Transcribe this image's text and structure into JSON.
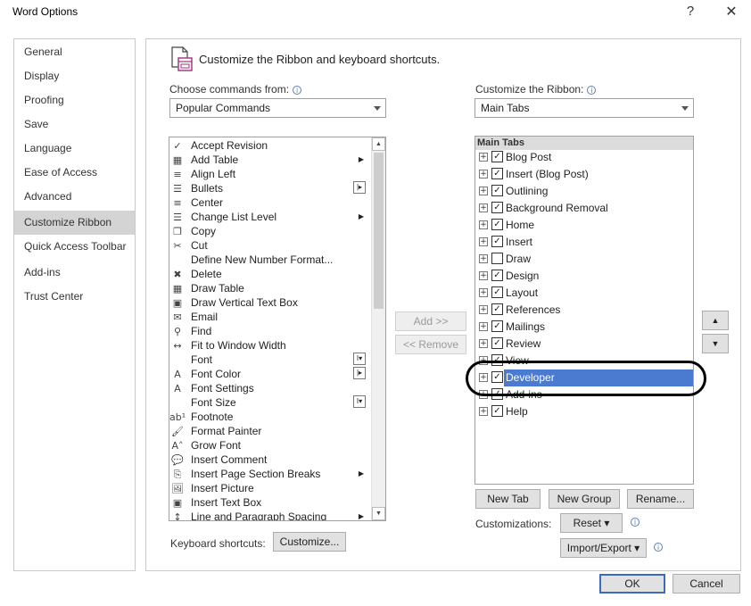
{
  "window": {
    "title": "Word Options",
    "help_label": "?",
    "close_label": "✕"
  },
  "nav": {
    "items": [
      {
        "label": "General"
      },
      {
        "label": "Display"
      },
      {
        "label": "Proofing"
      },
      {
        "label": "Save"
      },
      {
        "label": "Language"
      },
      {
        "label": "Ease of Access"
      },
      {
        "label": "Advanced"
      },
      {
        "label": "Customize Ribbon",
        "selected": true
      },
      {
        "label": "Quick Access Toolbar"
      },
      {
        "label": "Add-ins"
      },
      {
        "label": "Trust Center"
      }
    ]
  },
  "header": {
    "text": "Customize the Ribbon and keyboard shortcuts."
  },
  "left_panel": {
    "choose_label": "Choose commands from:",
    "choose_value": "Popular Commands",
    "commands": [
      {
        "label": "Accept Revision",
        "icon": "accept-icon",
        "glyph": "✓"
      },
      {
        "label": "Add Table",
        "icon": "table-icon",
        "glyph": "▦",
        "submenu": true
      },
      {
        "label": "Align Left",
        "icon": "align-left-icon",
        "glyph": "≡"
      },
      {
        "label": "Bullets",
        "icon": "bullets-icon",
        "glyph": "☰",
        "control": "|▸"
      },
      {
        "label": "Center",
        "icon": "center-icon",
        "glyph": "≡"
      },
      {
        "label": "Change List Level",
        "icon": "list-level-icon",
        "glyph": "☰",
        "submenu": true
      },
      {
        "label": "Copy",
        "icon": "copy-icon",
        "glyph": "❐"
      },
      {
        "label": "Cut",
        "icon": "cut-icon",
        "glyph": "✂"
      },
      {
        "label": "Define New Number Format...",
        "icon": "",
        "glyph": ""
      },
      {
        "label": "Delete",
        "icon": "delete-icon",
        "glyph": "✖"
      },
      {
        "label": "Draw Table",
        "icon": "draw-table-icon",
        "glyph": "▦"
      },
      {
        "label": "Draw Vertical Text Box",
        "icon": "text-box-icon",
        "glyph": "▣"
      },
      {
        "label": "Email",
        "icon": "email-icon",
        "glyph": "✉"
      },
      {
        "label": "Find",
        "icon": "find-icon",
        "glyph": "⚲"
      },
      {
        "label": "Fit to Window Width",
        "icon": "fit-width-icon",
        "glyph": "↔"
      },
      {
        "label": "Font",
        "icon": "",
        "glyph": "",
        "control": "I▾"
      },
      {
        "label": "Font Color",
        "icon": "font-color-icon",
        "glyph": "A",
        "control": "|▸"
      },
      {
        "label": "Font Settings",
        "icon": "font-settings-icon",
        "glyph": "A"
      },
      {
        "label": "Font Size",
        "icon": "",
        "glyph": "",
        "control": "I▾"
      },
      {
        "label": "Footnote",
        "icon": "footnote-icon",
        "glyph": "ab¹"
      },
      {
        "label": "Format Painter",
        "icon": "format-painter-icon",
        "glyph": "🖌"
      },
      {
        "label": "Grow Font",
        "icon": "grow-font-icon",
        "glyph": "A˄"
      },
      {
        "label": "Insert Comment",
        "icon": "comment-icon",
        "glyph": "💬"
      },
      {
        "label": "Insert Page  Section Breaks",
        "icon": "page-break-icon",
        "glyph": "⎘",
        "submenu": true
      },
      {
        "label": "Insert Picture",
        "icon": "picture-icon",
        "glyph": "🖼"
      },
      {
        "label": "Insert Text Box",
        "icon": "text-box-icon",
        "glyph": "▣"
      },
      {
        "label": "Line and Paragraph Spacing",
        "icon": "line-spacing-icon",
        "glyph": "↕",
        "submenu": true
      }
    ]
  },
  "middle": {
    "add_label": "Add >>",
    "remove_label": "<< Remove"
  },
  "right_panel": {
    "customize_label": "Customize the Ribbon:",
    "customize_value": "Main Tabs",
    "tree_header": "Main Tabs",
    "tabs": [
      {
        "label": "Blog Post",
        "checked": true
      },
      {
        "label": "Insert (Blog Post)",
        "checked": true
      },
      {
        "label": "Outlining",
        "checked": true
      },
      {
        "label": "Background Removal",
        "checked": true
      },
      {
        "label": "Home",
        "checked": true
      },
      {
        "label": "Insert",
        "checked": true
      },
      {
        "label": "Draw",
        "checked": false
      },
      {
        "label": "Design",
        "checked": true
      },
      {
        "label": "Layout",
        "checked": true
      },
      {
        "label": "References",
        "checked": true
      },
      {
        "label": "Mailings",
        "checked": true
      },
      {
        "label": "Review",
        "checked": true
      },
      {
        "label": "View",
        "checked": true
      },
      {
        "label": "Developer",
        "checked": true,
        "selected": true
      },
      {
        "label": "Add-ins",
        "checked": true
      },
      {
        "label": "Help",
        "checked": true
      }
    ],
    "new_tab_label": "New Tab",
    "new_group_label": "New Group",
    "rename_label": "Rename...",
    "customizations_label": "Customizations:",
    "reset_label": "Reset ▾",
    "import_export_label": "Import/Export ▾",
    "move_up_label": "▲",
    "move_down_label": "▼"
  },
  "footer": {
    "keyboard_label": "Keyboard shortcuts:",
    "customize_button": "Customize...",
    "ok_label": "OK",
    "cancel_label": "Cancel"
  },
  "colors": {
    "selection": "#4a7bd0",
    "nav_selected": "#d4d4d4",
    "annotation_circle": "#000000"
  }
}
